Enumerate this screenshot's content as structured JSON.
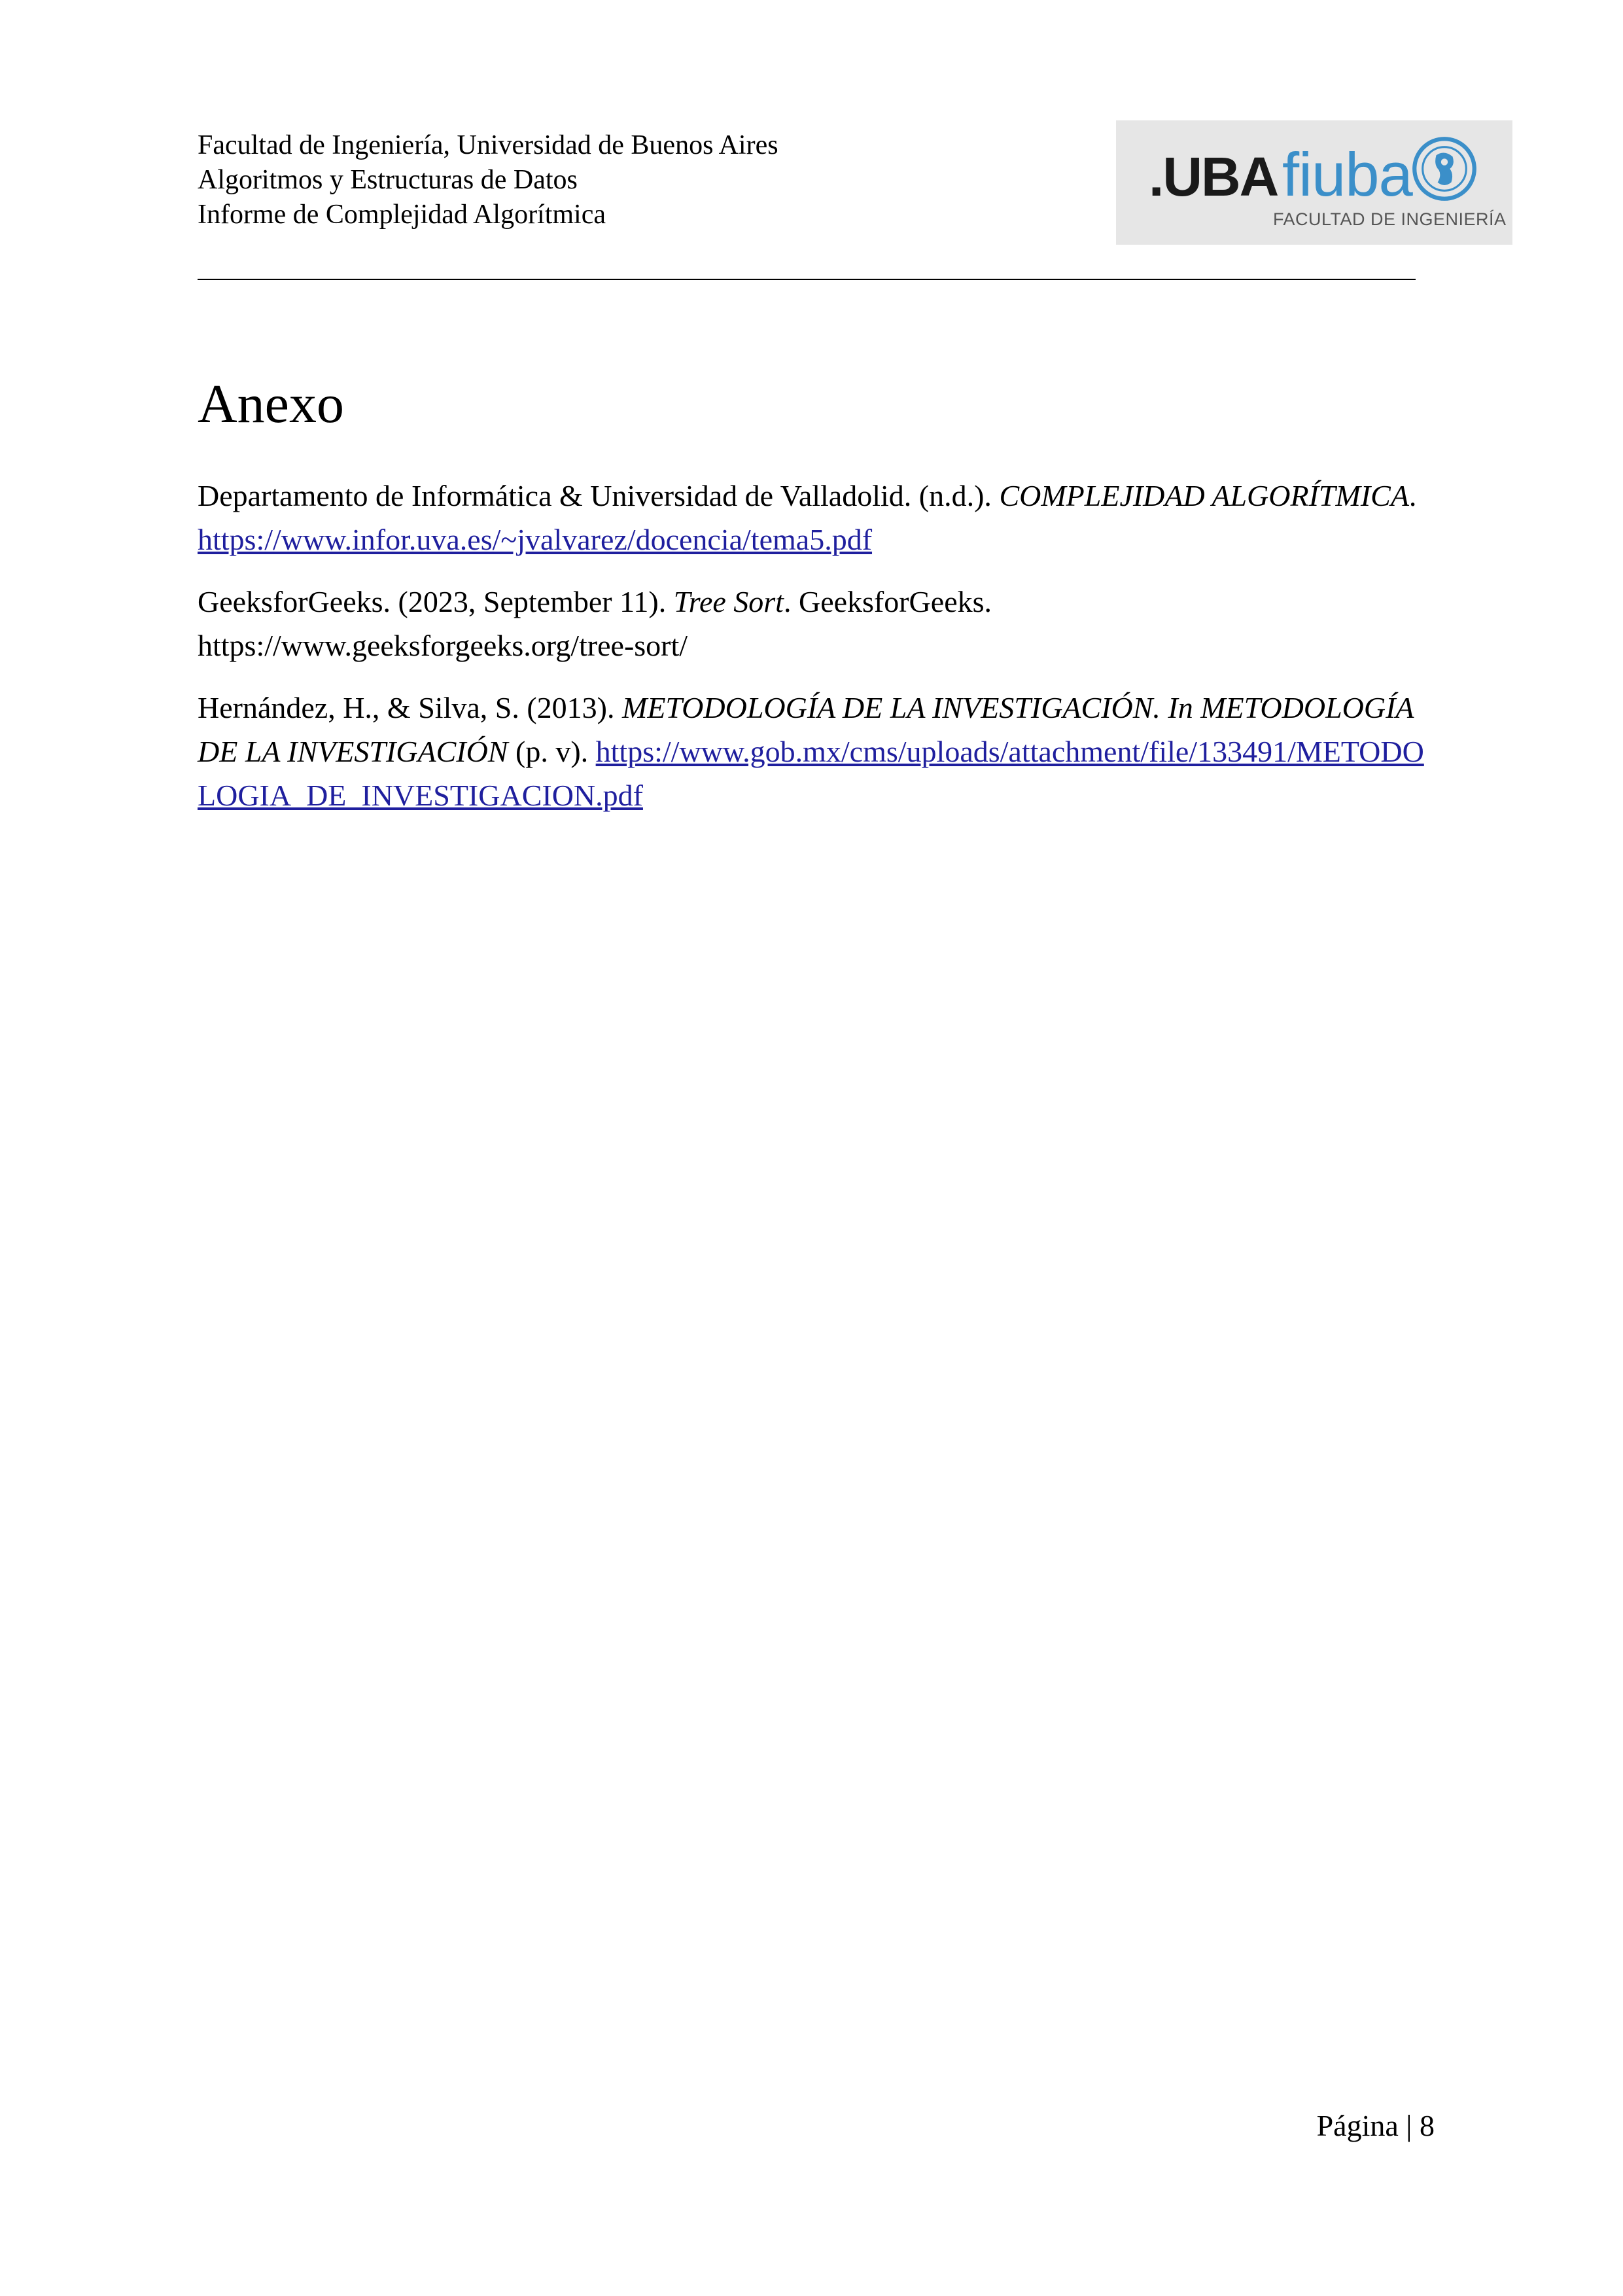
{
  "header": {
    "line1": "Facultad de Ingeniería, Universidad de Buenos Aires",
    "line2": "Algoritmos y Estructuras de Datos",
    "line3": "Informe de Complejidad Algorítmica",
    "logo": {
      "uba": ".UBA",
      "fiuba": "fiuba",
      "subtitle": "FACULTAD DE INGENIERÍA",
      "emblem_icon": "fiuba-emblem-icon",
      "colors": {
        "background": "#e6e6e6",
        "fiuba_blue": "#3b8fc9",
        "uba_dark": "#1a1a1a"
      }
    }
  },
  "title": "Anexo",
  "references": [
    {
      "part1": "Departamento de Informática & Universidad de Valladolid. (n.d.). ",
      "italic1": "COMPLEJIDAD ALGORÍTMICA",
      "part2": ". ",
      "link": "https://www.infor.uva.es/~jvalvarez/docencia/tema5.pdf"
    },
    {
      "part1": "GeeksforGeeks. (2023, September 11). ",
      "italic1": "Tree Sort",
      "part2": ". GeeksforGeeks. https://www.geeksforgeeks.org/tree-sort/"
    },
    {
      "part1": "Hernández, H., & Silva, S. (2013). ",
      "italic1": "METODOLOGÍA DE LA INVESTIGACIÓN. In METODOLOGÍA DE LA INVESTIGACIÓN",
      "part2": " (p. v). ",
      "link": "https://www.gob.mx/cms/uploads/attachment/file/133491/METODOLOGIA_DE_INVESTIGACION.pdf"
    }
  ],
  "footer": {
    "page_label": "Página | 8"
  },
  "colors": {
    "link": "#1f1f9e",
    "text": "#000000"
  }
}
